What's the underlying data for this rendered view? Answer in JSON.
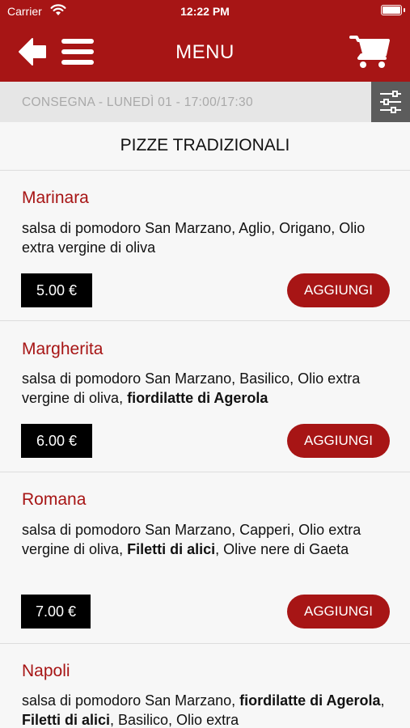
{
  "status_bar": {
    "carrier": "Carrier",
    "time": "12:22 PM",
    "battery_level": 1.0
  },
  "nav": {
    "title": "MENU"
  },
  "delivery": {
    "text": "CONSEGNA - LUNEDÌ 01 - 17:00/17:30"
  },
  "section": {
    "title": "PIZZE TRADIZIONALI"
  },
  "items": [
    {
      "name": "Marinara",
      "desc": [
        {
          "t": "salsa di pomodoro San Marzano, Aglio, Origano, Olio extra vergine di oliva",
          "b": false
        }
      ],
      "price": "5.00 €",
      "add_label": "AGGIUNGI"
    },
    {
      "name": "Margherita",
      "desc": [
        {
          "t": "salsa di pomodoro San Marzano, Basilico, Olio extra vergine di oliva, ",
          "b": false
        },
        {
          "t": "fiordilatte di Agerola",
          "b": true
        }
      ],
      "price": "6.00 €",
      "add_label": "AGGIUNGI"
    },
    {
      "name": "Romana",
      "desc": [
        {
          "t": "salsa di pomodoro San Marzano, Capperi, Olio extra vergine di oliva, ",
          "b": false
        },
        {
          "t": "Filetti di alici",
          "b": true
        },
        {
          "t": ", Olive nere di Gaeta",
          "b": false
        }
      ],
      "price": "7.00 €",
      "add_label": "AGGIUNGI"
    },
    {
      "name": "Napoli",
      "desc": [
        {
          "t": "salsa di pomodoro San Marzano, ",
          "b": false
        },
        {
          "t": "fiordilatte di Agerola",
          "b": true
        },
        {
          "t": ", ",
          "b": false
        },
        {
          "t": "Filetti di alici",
          "b": true
        },
        {
          "t": ", Basilico, Olio extra",
          "b": false
        }
      ]
    }
  ],
  "colors": {
    "brand": "#a71515",
    "delivery_bar": "#e6e6e6",
    "filter_button": "#5c5c5c"
  },
  "icons": {
    "back": "arrow-left-icon",
    "menu": "hamburger-icon",
    "cart": "cart-icon",
    "filter": "sliders-icon",
    "wifi": "wifi-icon",
    "battery": "battery-icon"
  }
}
